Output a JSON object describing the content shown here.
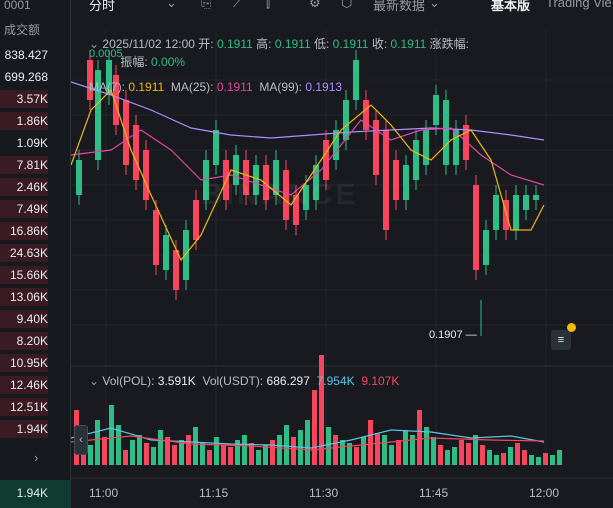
{
  "order_book": {
    "top_value": "0001",
    "header": "成交额",
    "rows": [
      {
        "value": "838.427",
        "bar": false
      },
      {
        "value": "699.268",
        "bar": false
      },
      {
        "value": "3.57K",
        "bar": true
      },
      {
        "value": "1.86K",
        "bar": true
      },
      {
        "value": "1.09K",
        "bar": false
      },
      {
        "value": "7.81K",
        "bar": true
      },
      {
        "value": "2.46K",
        "bar": true
      },
      {
        "value": "7.49K",
        "bar": true
      },
      {
        "value": "16.86K",
        "bar": true
      },
      {
        "value": "24.63K",
        "bar": true
      },
      {
        "value": "15.66K",
        "bar": true
      },
      {
        "value": "13.06K",
        "bar": true
      },
      {
        "value": "9.40K",
        "bar": true
      },
      {
        "value": "8.20K",
        "bar": true
      },
      {
        "value": "10.95K",
        "bar": true
      },
      {
        "value": "12.46K",
        "bar": true
      },
      {
        "value": "12.51K",
        "bar": true
      },
      {
        "value": "1.94K",
        "bar": true
      }
    ],
    "footer": "1.94K"
  },
  "toolbar": {
    "interval": "分时",
    "latest_data": "最新数据",
    "basic_version": "基本版",
    "trading_view": "Trading Vie"
  },
  "ohlc": {
    "time": "2025/11/02 12:00",
    "open_label": "开:",
    "open": "0.1911",
    "high_label": "高:",
    "high": "0.1911",
    "low_label": "低:",
    "low": "0.1911",
    "close_label": "收:",
    "close": "0.1911",
    "change_label": "涨跌幅:",
    "change_overlay": "0.0005",
    "amp_label": "振幅:",
    "amp": "0.00%"
  },
  "ma": {
    "ma7_label": "MA(7):",
    "ma7": "0.1911",
    "ma25_label": "MA(25):",
    "ma25": "0.1911",
    "ma99_label": "MA(99):",
    "ma99": "0.1913"
  },
  "vol": {
    "pol_label": "Vol(POL):",
    "pol": "3.591K",
    "usdt_label": "Vol(USDT):",
    "usdt": "686.297",
    "usdt_ma1": "7.954K",
    "usdt_ma2": "9.107K"
  },
  "min_price_label": "0.1907",
  "watermark": "BINANCE",
  "x_ticks": [
    "11:00",
    "11:15",
    "11:30",
    "11:45",
    "12:00"
  ],
  "colors": {
    "up": "#2ebd85",
    "down": "#f6465d",
    "ma7": "#f0b90b",
    "ma25": "#e0479e",
    "ma99": "#b08cff"
  }
}
